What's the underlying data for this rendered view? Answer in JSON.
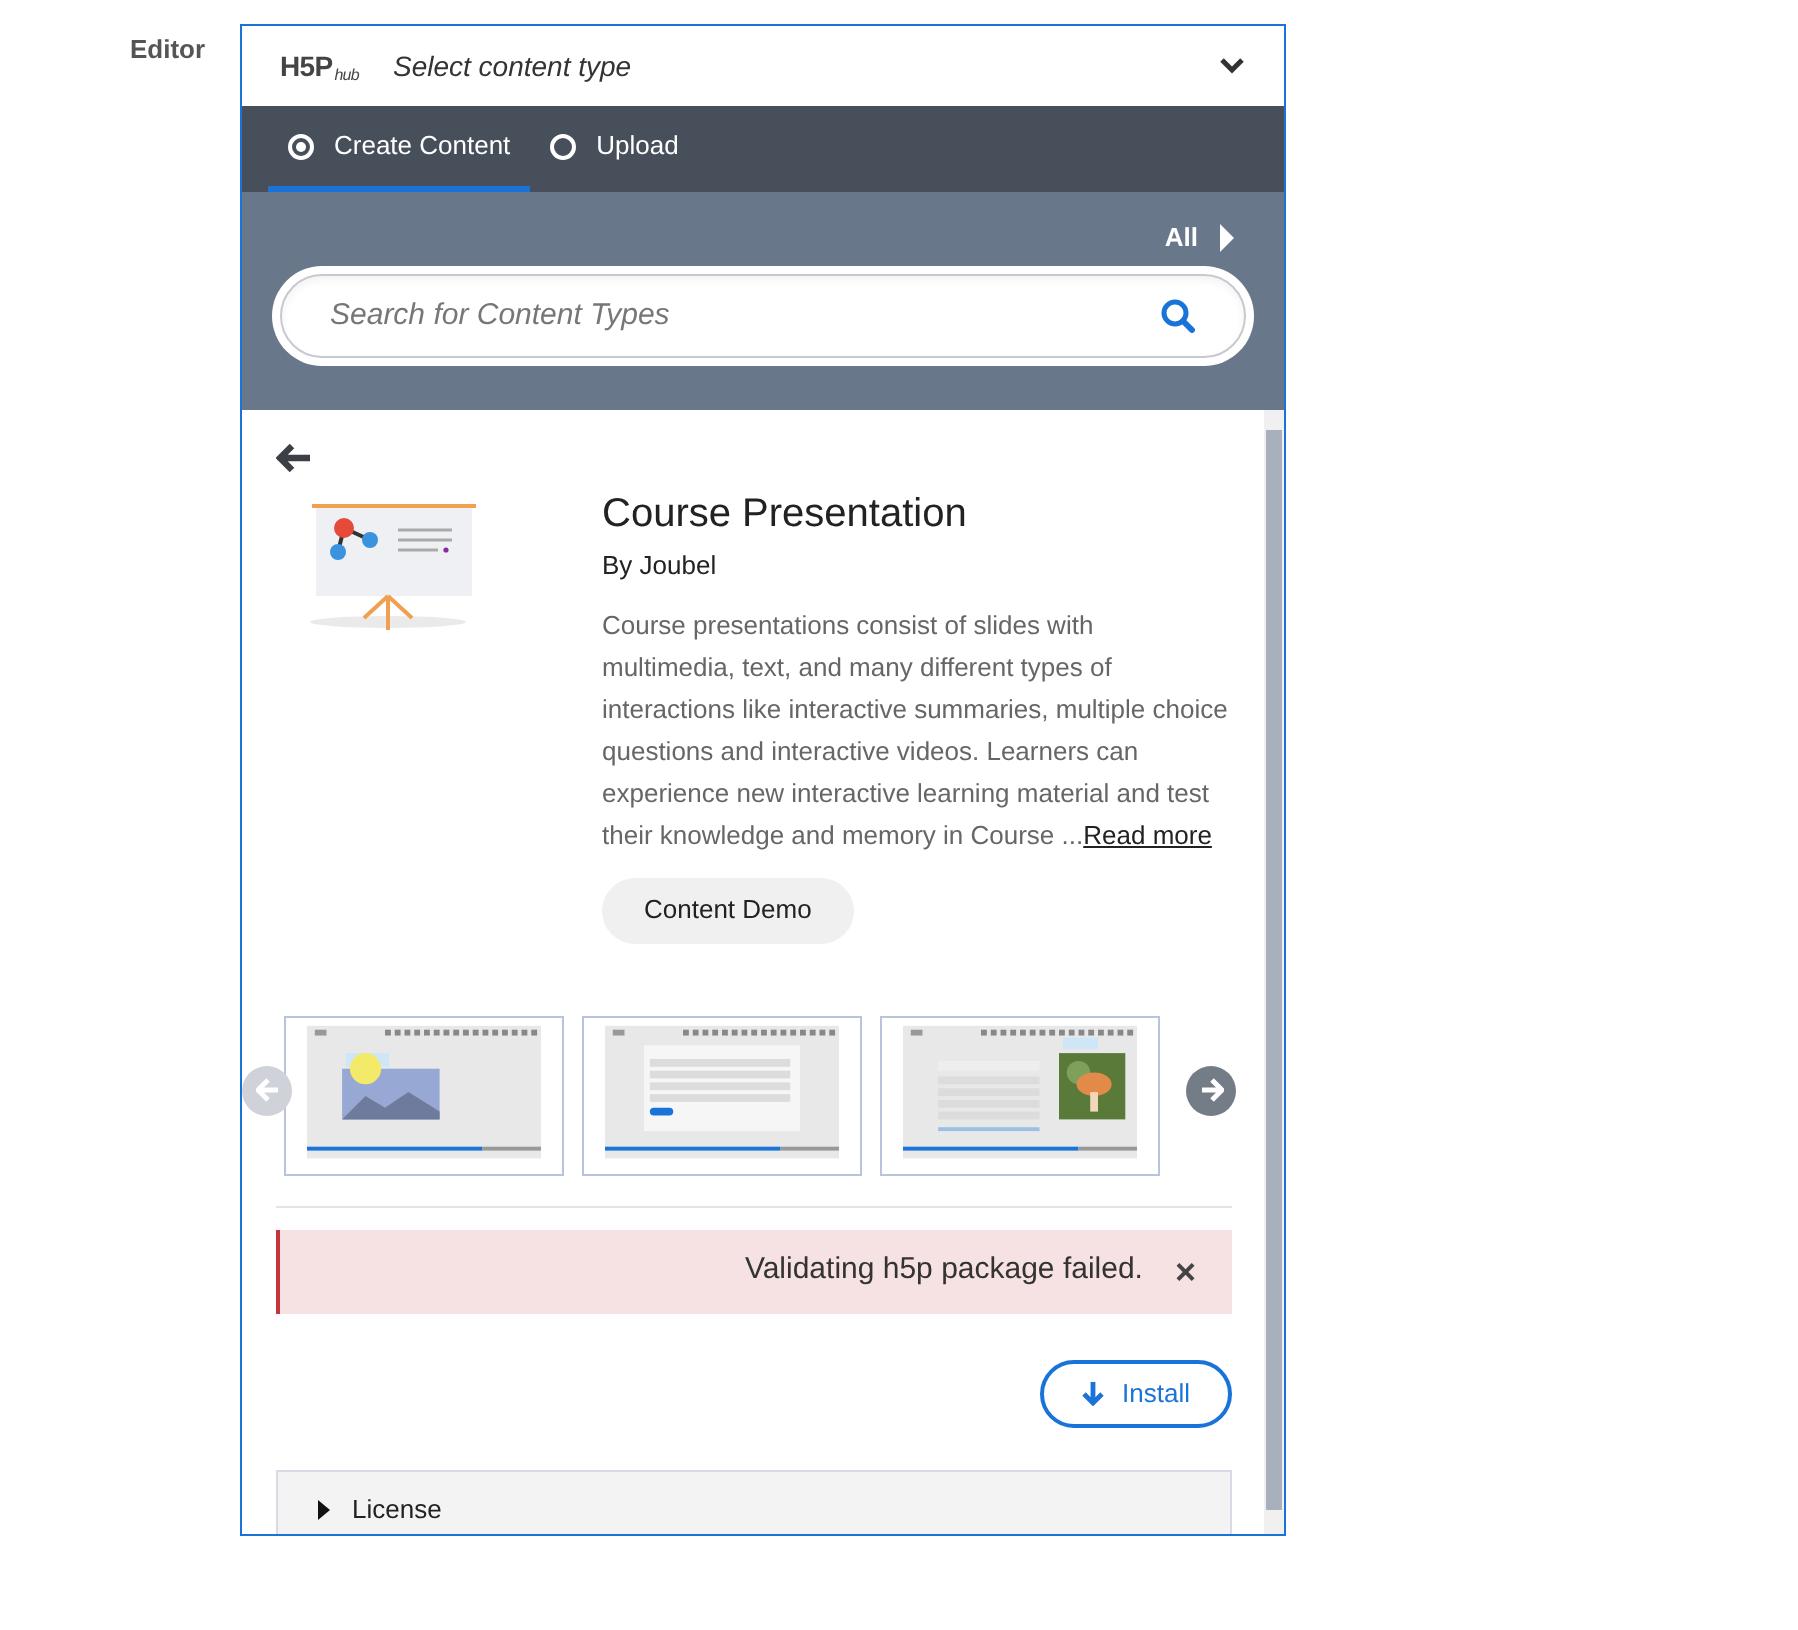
{
  "field_label": "Editor",
  "hub": {
    "logo": {
      "mark": "H5P",
      "sub": "hub"
    },
    "title": "Select content type",
    "expanded": true
  },
  "tabs": [
    {
      "label": "Create Content",
      "selected": true
    },
    {
      "label": "Upload",
      "selected": false
    }
  ],
  "filter": {
    "label": "All"
  },
  "search": {
    "placeholder": "Search for Content Types"
  },
  "detail": {
    "title": "Course Presentation",
    "author": "By Joubel",
    "description": "Course presentations consist of slides with multimedia, text, and many different types of interactions like interactive summaries, multiple choice questions and interactive videos. Learners can experience new interactive learning material and test their knowledge and memory in Course ...",
    "read_more": "Read more",
    "demo_button": "Content Demo",
    "carousel": {
      "prev_disabled": true,
      "next_disabled": false,
      "slides": [
        {
          "kind": "image"
        },
        {
          "kind": "quiz"
        },
        {
          "kind": "picture"
        }
      ]
    },
    "alert": {
      "message": "Validating h5p package failed.",
      "close": "×"
    },
    "install_button": "Install",
    "license": {
      "label": "License",
      "expanded": false
    }
  }
}
